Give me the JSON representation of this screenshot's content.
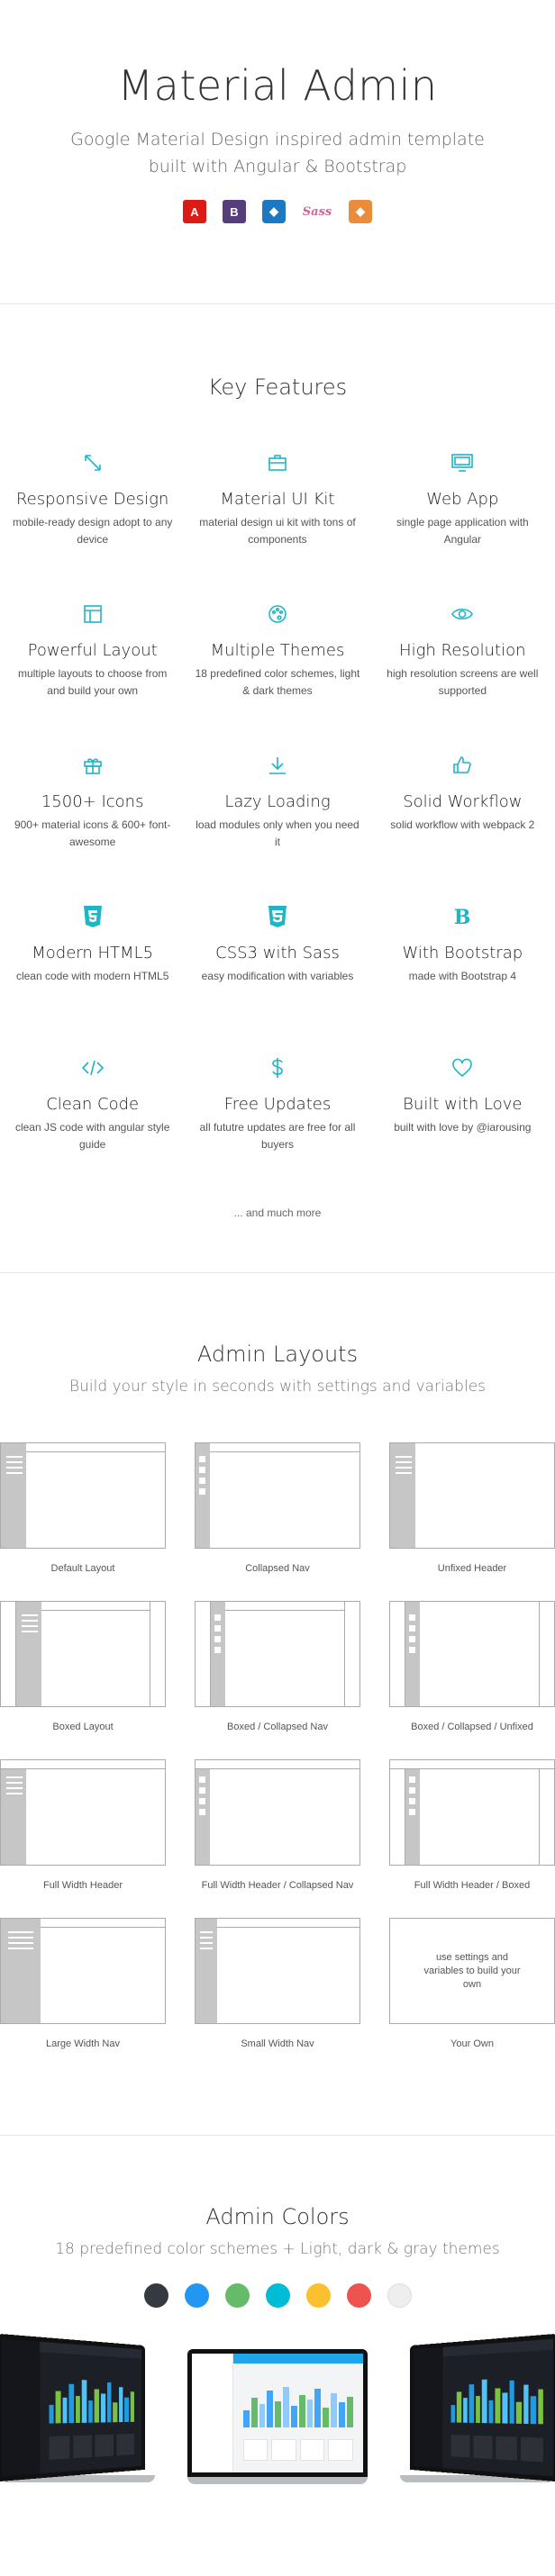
{
  "hero": {
    "title": "Material Admin",
    "subtitle_line1": "Google Material Design inspired admin template",
    "subtitle_line2": "built with Angular & Bootstrap",
    "logos": [
      {
        "name": "angular-logo",
        "glyph": "A",
        "color": "#dd1b16"
      },
      {
        "name": "bootstrap-logo",
        "glyph": "B",
        "color": "#563d7c"
      },
      {
        "name": "webpack-logo",
        "glyph": "◆",
        "color": "#1c78c0"
      },
      {
        "name": "sass-logo",
        "glyph": "Sass",
        "color": "#cd6799"
      },
      {
        "name": "gulp-logo",
        "glyph": "◆",
        "color": "#eb8b3c"
      }
    ]
  },
  "features": {
    "title": "Key Features",
    "items": [
      {
        "icon": "resize-icon",
        "title": "Responsive Design",
        "desc": "mobile-ready design adopt to any device"
      },
      {
        "icon": "briefcase-icon",
        "title": "Material UI Kit",
        "desc": "material design ui kit with tons of components"
      },
      {
        "icon": "monitor-icon",
        "title": "Web App",
        "desc": "single page application with Angular"
      },
      {
        "icon": "layout-icon",
        "title": "Powerful Layout",
        "desc": "multiple layouts to choose from and build your own"
      },
      {
        "icon": "palette-icon",
        "title": "Multiple Themes",
        "desc": "18 predefined color schemes, light & dark themes"
      },
      {
        "icon": "eye-icon",
        "title": "High Resolution",
        "desc": "high resolution screens are well supported"
      },
      {
        "icon": "gift-icon",
        "title": "1500+ Icons",
        "desc": "900+ material icons & 600+ font-awesome"
      },
      {
        "icon": "download-icon",
        "title": "Lazy Loading",
        "desc": "load modules only when you need it"
      },
      {
        "icon": "thumbs-up-icon",
        "title": "Solid Workflow",
        "desc": "solid workflow with webpack 2"
      },
      {
        "icon": "html5-icon",
        "title": "Modern HTML5",
        "desc": "clean code with modern HTML5"
      },
      {
        "icon": "css3-icon",
        "title": "CSS3 with Sass",
        "desc": "easy modification with variables"
      },
      {
        "icon": "bootstrap-icon",
        "title": "With Bootstrap",
        "desc": "made with Bootstrap 4"
      },
      {
        "icon": "code-icon",
        "title": "Clean Code",
        "desc": "clean JS code with angular style guide"
      },
      {
        "icon": "dollar-icon",
        "title": "Free Updates",
        "desc": "all fututre updates are free for all buyers"
      },
      {
        "icon": "heart-icon",
        "title": "Built with Love",
        "desc": "built with love by @iarousing"
      }
    ],
    "more": "... and much more"
  },
  "layouts": {
    "title": "Admin Layouts",
    "subtitle": "Build your style in seconds with settings and variables",
    "items": [
      {
        "label": "Default Layout"
      },
      {
        "label": "Collapsed Nav"
      },
      {
        "label": "Unfixed Header"
      },
      {
        "label": "Boxed Layout"
      },
      {
        "label": "Boxed / Collapsed Nav"
      },
      {
        "label": "Boxed / Collapsed / Unfixed"
      },
      {
        "label": "Full Width Header"
      },
      {
        "label": "Full Width Header / Collapsed Nav"
      },
      {
        "label": "Full Width Header / Boxed"
      },
      {
        "label": "Large Width Nav"
      },
      {
        "label": "Small Width Nav"
      },
      {
        "label": "Your Own",
        "thumb_text": "use settings and variables to build your own"
      }
    ]
  },
  "colors": {
    "title": "Admin Colors",
    "subtitle": "18 predefined color schemes + Light, dark & gray themes",
    "swatches": [
      "#343a40",
      "#2196f3",
      "#66bb6a",
      "#00bcd4",
      "#fbc02d",
      "#ef5350",
      "#eeeeee"
    ]
  }
}
